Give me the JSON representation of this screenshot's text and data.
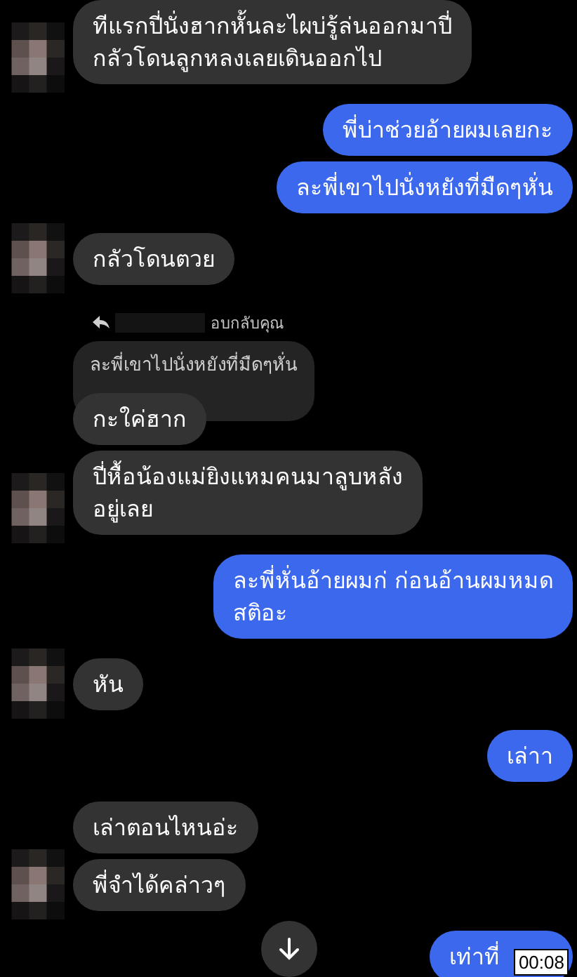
{
  "groups": [
    {
      "kind": "incoming",
      "messages": [
        {
          "kind": "text",
          "text": "ทีแรกปี่นั่งฮากหั้นละไผบ่รู้ล่นออกมาปี่\nกลัวโดนลูกหลงเลยเดินออกไป"
        }
      ]
    },
    {
      "kind": "outgoing",
      "messages": [
        {
          "kind": "text",
          "text": "พี่บ่าช่วยอ้ายผมเลยกะ"
        },
        {
          "kind": "text",
          "text": "ละพี่เขาไปนั่งหยังที่มืดๆหั่น"
        }
      ]
    },
    {
      "kind": "incoming",
      "messages": [
        {
          "kind": "text",
          "text": "กลัวโดนตวย"
        }
      ]
    },
    {
      "kind": "incoming",
      "messages": [
        {
          "kind": "reply",
          "label": "อบกลับคุณ",
          "quoted": "ละพี่เขาไปนั่งหยังที่มืดๆหั่น"
        },
        {
          "kind": "text",
          "text": "กะใค่ฮาก"
        },
        {
          "kind": "text",
          "text": "ปี่หื้อน้องแม่ยิงแหมคนมาลูบหลัง\nอยู่เลย"
        }
      ]
    },
    {
      "kind": "outgoing",
      "messages": [
        {
          "kind": "text",
          "text": "ละพี่หั่นอ้ายผมก่ ก่อนอ้านผมหมด\nสติอะ"
        }
      ]
    },
    {
      "kind": "incoming",
      "messages": [
        {
          "kind": "text",
          "text": "หัน"
        }
      ]
    },
    {
      "kind": "outgoing",
      "messages": [
        {
          "kind": "text",
          "text": "เล่าา"
        }
      ]
    },
    {
      "kind": "incoming",
      "messages": [
        {
          "kind": "text",
          "text": "เล่าตอนไหนอ่ะ"
        },
        {
          "kind": "text",
          "text": "พี่จำได้คล่าวๆ"
        }
      ]
    },
    {
      "kind": "outgoing",
      "messages": [
        {
          "kind": "text",
          "text": "เท่าที่"
        }
      ]
    }
  ],
  "timestamp": "00:08"
}
